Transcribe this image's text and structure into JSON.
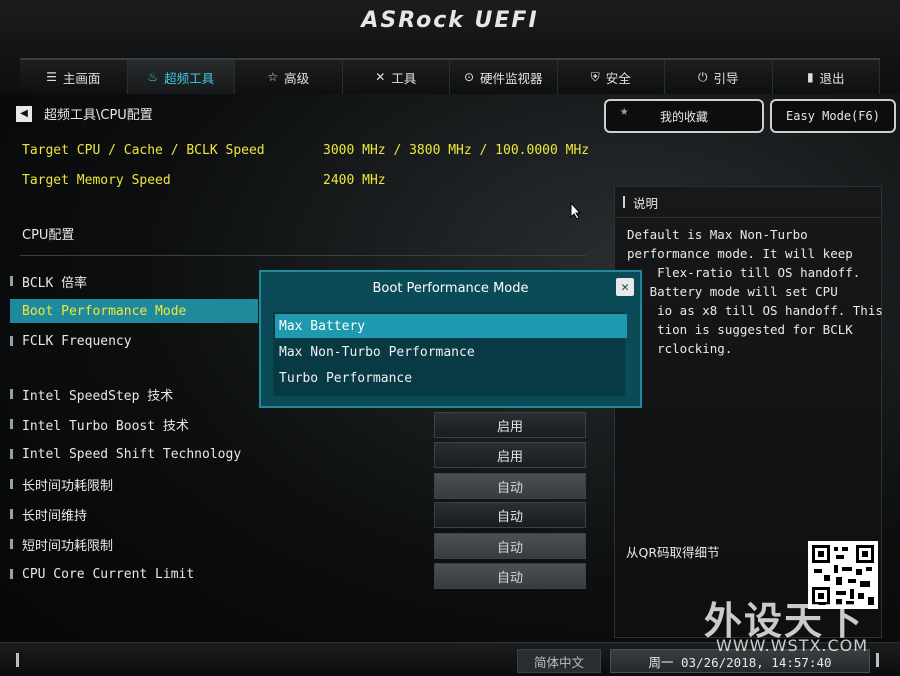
{
  "brand": {
    "logo_text": "ASRock UEFI"
  },
  "tabs": [
    {
      "label": "主画面",
      "icon": "list-icon"
    },
    {
      "label": "超频工具",
      "icon": "flame-icon",
      "active": true
    },
    {
      "label": "高级",
      "icon": "star-icon"
    },
    {
      "label": "工具",
      "icon": "wrench-icon"
    },
    {
      "label": "硬件监视器",
      "icon": "gauge-icon"
    },
    {
      "label": "安全",
      "icon": "shield-icon"
    },
    {
      "label": "引导",
      "icon": "power-icon"
    },
    {
      "label": "退出",
      "icon": "door-icon"
    }
  ],
  "breadcrumb": "超频工具\\CPU配置",
  "favorites_label": "我的收藏",
  "easy_mode_label": "Easy Mode(F6)",
  "info": [
    {
      "label": "Target CPU / Cache / BCLK Speed",
      "value": "3000 MHz / 3800 MHz / 100.0000 MHz"
    },
    {
      "label": "Target Memory Speed",
      "value": "2400 MHz"
    }
  ],
  "section_title": "CPU配置",
  "items": [
    {
      "label": "BCLK 倍率",
      "value": ""
    },
    {
      "label": "Boot Performance Mode",
      "value": ""
    },
    {
      "label": "FCLK Frequency",
      "value": ""
    },
    {
      "label": "Intel SpeedStep 技术",
      "value": ""
    },
    {
      "label": "Intel Turbo Boost 技术",
      "value": "启用"
    },
    {
      "label": "Intel Speed Shift Technology",
      "value": "启用"
    },
    {
      "label": "长时间功耗限制",
      "value": "自动"
    },
    {
      "label": "长时间维持",
      "value": "自动"
    },
    {
      "label": "短时间功耗限制",
      "value": "自动"
    },
    {
      "label": "CPU Core Current Limit",
      "value": "自动"
    }
  ],
  "help": {
    "title": "说明",
    "lines": [
      "Default is Max Non-Turbo",
      "performance mode. It will keep",
      "    Flex-ratio till OS handoff.",
      "   Battery mode will set CPU",
      "    io as x8 till OS handoff. This",
      "    tion is suggested for BCLK",
      "    rclocking."
    ],
    "qr_label": "从QR码取得细节"
  },
  "modal": {
    "title": "Boot Performance Mode",
    "options": [
      "Max Battery",
      "Max Non-Turbo Performance",
      "Turbo Performance"
    ],
    "selected_index": 0
  },
  "footer": {
    "language": "简体中文",
    "datetime": "周一 03/26/2018, 14:57:40"
  },
  "watermark": {
    "main": "外设天下",
    "sub": "WWW.WSTX.COM"
  },
  "colors": {
    "accent": "#1e8a9c",
    "highlight_text": "#f0e63a",
    "modal_bg": "#0a4b57"
  }
}
